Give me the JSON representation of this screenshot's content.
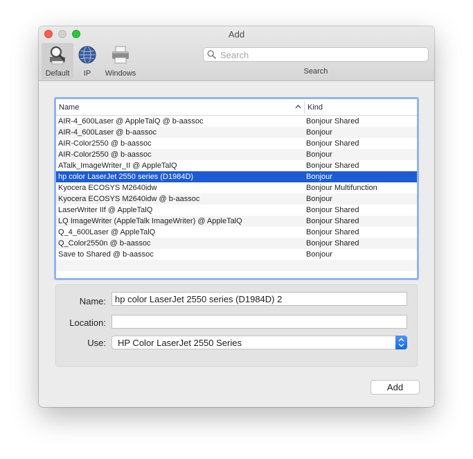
{
  "window": {
    "title": "Add"
  },
  "toolbar": {
    "buttons": [
      {
        "label": "Default",
        "icon": "magnifier-printer-icon",
        "active": true
      },
      {
        "label": "IP",
        "icon": "globe-icon",
        "active": false
      },
      {
        "label": "Windows",
        "icon": "printer-icon",
        "active": false
      }
    ],
    "search": {
      "placeholder": "Search",
      "value": "",
      "label": "Search"
    }
  },
  "table": {
    "columns": [
      "Name",
      "Kind"
    ],
    "sort_indicator": "ascending",
    "rows": [
      {
        "name": "AIR-4_600Laser @ AppleTalQ @ b-aassoc",
        "kind": "Bonjour Shared"
      },
      {
        "name": "AIR-4_600Laser @ b-aassoc",
        "kind": "Bonjour"
      },
      {
        "name": "AIR-Color2550 @ b-aassoc",
        "kind": "Bonjour Shared"
      },
      {
        "name": "AIR-Color2550 @ b-aassoc",
        "kind": "Bonjour"
      },
      {
        "name": "ATalk_ImageWriter_II @ AppleTalQ",
        "kind": "Bonjour Shared"
      },
      {
        "name": "hp color LaserJet 2550 series (D1984D)",
        "kind": "Bonjour",
        "selected": true
      },
      {
        "name": "Kyocera ECOSYS M2640idw",
        "kind": "Bonjour Multifunction"
      },
      {
        "name": "Kyocera ECOSYS M2640idw @ b-aassoc",
        "kind": "Bonjour"
      },
      {
        "name": "LaserWriter IIf @ AppleTalQ",
        "kind": "Bonjour Shared"
      },
      {
        "name": "LQ ImageWriter (AppleTalk ImageWriter) @ AppleTalQ",
        "kind": "Bonjour Shared"
      },
      {
        "name": "Q_4_600Laser @ AppleTalQ",
        "kind": "Bonjour Shared"
      },
      {
        "name": "Q_Color2550n @ b-aassoc",
        "kind": "Bonjour Shared"
      },
      {
        "name": "Save to Shared @ b-aassoc",
        "kind": "Bonjour"
      }
    ]
  },
  "form": {
    "name_label": "Name:",
    "name_value": "hp color LaserJet 2550 series (D1984D) 2",
    "location_label": "Location:",
    "location_value": "",
    "use_label": "Use:",
    "use_value": "HP Color LaserJet 2550 Series"
  },
  "add_label": "Add",
  "colors": {
    "selection": "#1d5bd6",
    "focus_ring": "#91b4ef",
    "close": "#fe5f57",
    "zoom": "#28c840"
  }
}
